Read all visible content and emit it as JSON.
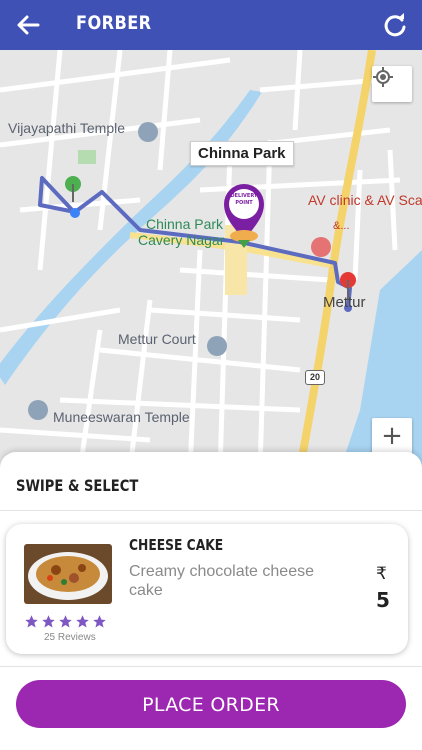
{
  "appbar": {
    "title": "FORBER",
    "back_icon": "arrow-left-icon",
    "refresh_icon": "refresh-icon",
    "color": "#3f51b5"
  },
  "map": {
    "callout": "Chinna Park",
    "delivery_marker": {
      "line1": "DELIVERY",
      "line2": "POINT"
    },
    "labels": {
      "vijayapathi": "Vijayapathi Temple",
      "chinna_park_1": "Chinna Park",
      "chinna_park_2": "Cavery Nagar",
      "av_clinic": "AV clinic & AV Sca",
      "av_amp": "&...",
      "mettur": "Mettur",
      "mettur_court": "Mettur Court",
      "muneeswaran": "Muneeswaran Temple"
    },
    "road_badge": "20",
    "route_color": "#5c6bc0"
  },
  "sheet": {
    "heading": "SWIPE & SELECT",
    "item": {
      "name": "CHEESE CAKE",
      "description": "Creamy chocolate cheese cake",
      "currency": "₹",
      "price": "5",
      "rating": 5,
      "reviews": "25 Reviews",
      "star_color": "#7e57c2"
    },
    "order_button": "PLACE ORDER",
    "order_color": "#9c27b0"
  }
}
